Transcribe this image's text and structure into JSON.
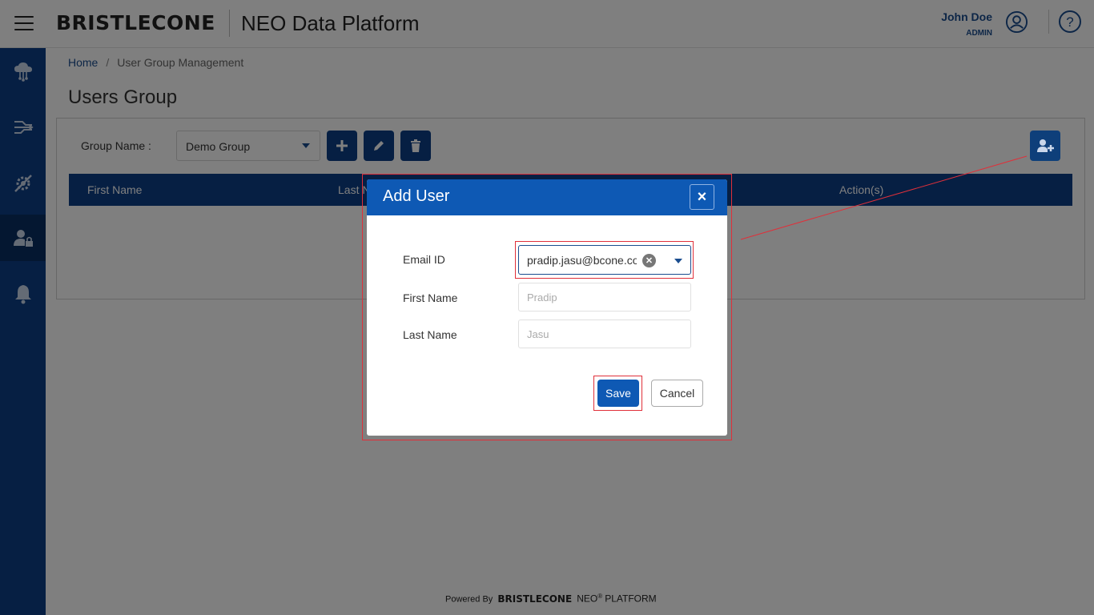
{
  "header": {
    "brand": "BRISTLECONE",
    "app_title": "NEO Data Platform",
    "user_name": "John Doe",
    "user_role": "ADMIN"
  },
  "sidebar": {
    "items": [
      {
        "icon": "cloud-network-icon"
      },
      {
        "icon": "data-flow-icon"
      },
      {
        "icon": "settings-tools-icon"
      },
      {
        "icon": "user-lock-icon",
        "active": true
      },
      {
        "icon": "bell-icon"
      }
    ]
  },
  "breadcrumb": {
    "home": "Home",
    "separator": "/",
    "current": "User Group Management"
  },
  "page": {
    "title": "Users Group"
  },
  "group": {
    "label": "Group Name :",
    "selected": "Demo Group"
  },
  "table": {
    "columns": [
      "First Name",
      "Last N",
      "Action(s)"
    ]
  },
  "modal": {
    "title": "Add User",
    "close_label": "×",
    "email_label": "Email ID",
    "email_value": "pradip.jasu@bcone.com",
    "first_name_label": "First Name",
    "first_name_placeholder": "Pradip",
    "last_name_label": "Last Name",
    "last_name_placeholder": "Jasu",
    "save_label": "Save",
    "cancel_label": "Cancel"
  },
  "footer": {
    "powered_by": "Powered By",
    "brand": "BRISTLECONE",
    "neo": "NEO",
    "registered": "®",
    "platform": "PLATFORM"
  },
  "colors": {
    "primary": "#0d3f86",
    "modal_header": "#0e59b4",
    "annotation": "#e0303a"
  }
}
